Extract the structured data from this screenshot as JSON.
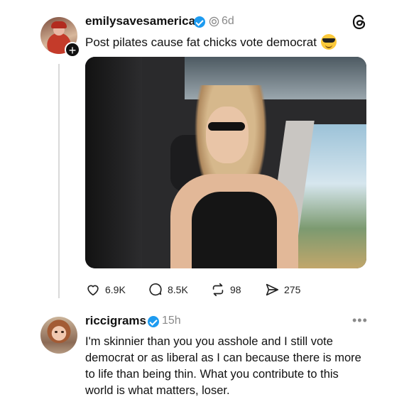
{
  "post": {
    "username": "emilysavesamerica",
    "time": "6d",
    "text": "Post pilates cause fat chicks vote democrat",
    "emoji_icon": "sunglasses-emoji-icon",
    "actions": {
      "likes": "6.9K",
      "comments": "8.5K",
      "reposts": "98",
      "shares": "275"
    }
  },
  "reply": {
    "username": "riccigrams",
    "time": "15h",
    "text": "I'm skinnier than you you asshole and I still vote democrat or as liberal as I can because there is more to life than being thin. What you contribute to this world is what matters, loser."
  },
  "colors": {
    "verified": "#1d9bf0",
    "muted": "#8a8a8a"
  }
}
